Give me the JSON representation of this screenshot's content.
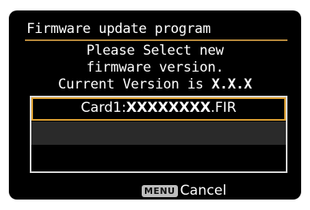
{
  "header": {
    "title": "Firmware update program"
  },
  "message": {
    "line1": "Please Select new",
    "line2": "firmware version.",
    "line3_prefix": "Current Version is ",
    "line3_version": "X.X.X"
  },
  "file_list": {
    "items": [
      {
        "prefix": "Card1:",
        "name": "XXXXXXXX",
        "ext": ".FIR",
        "selected": true
      },
      {
        "prefix": "",
        "name": "",
        "ext": "",
        "selected": false
      },
      {
        "prefix": "",
        "name": "",
        "ext": "",
        "selected": false
      }
    ]
  },
  "footer": {
    "menu_key": "MENU",
    "cancel_label": "Cancel"
  },
  "colors": {
    "accent": "#e0a233",
    "background": "#000000",
    "text": "#ffffff"
  }
}
